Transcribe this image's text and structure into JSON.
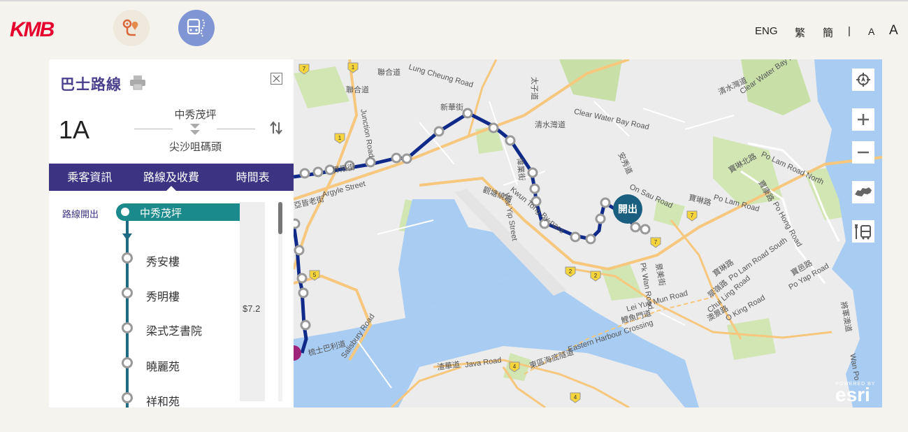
{
  "header": {
    "logo_text": "KMB",
    "route_search_icon": "route-pin-icon",
    "bus_stop_icon": "bus-stop-icon",
    "languages": [
      "ENG",
      "繁",
      "簡"
    ],
    "separator": "|",
    "font_small": "A",
    "font_large": "A",
    "brand_color": "#e5002d"
  },
  "panel": {
    "title": "巴士路線",
    "route_number": "1A",
    "from_terminus": "中秀茂坪",
    "to_terminus": "尖沙咀碼頭",
    "tabs": [
      {
        "label": "乘客資訊",
        "active": false
      },
      {
        "label": "路線及收費",
        "active": true
      },
      {
        "label": "時間表",
        "active": false
      }
    ],
    "origin_label": "路線開出",
    "origin_stop": "中秀茂坪",
    "stops": [
      "秀安樓",
      "秀明樓",
      "梁式芝書院",
      "曉麗苑",
      "祥和苑"
    ],
    "fare": "$7.2",
    "accent_color": "#3c3483",
    "origin_color": "#1a8a8c"
  },
  "map": {
    "start_badge": "開出",
    "labels": [
      "Lung Cheung Road",
      "Junction Road",
      "Clear Water Bay Road",
      "Argyle Street",
      "Kwun Tong By-pass",
      "Wai Yip Street",
      "On Sau Road",
      "Po Lam Road North",
      "Po Lam Road",
      "Po Hong Road",
      "Po Lam Road South",
      "Po Yap Road",
      "Chui Ling Road",
      "O King Road",
      "Wan Po",
      "Eastern Harbour Crossing",
      "Lei Yue Mun Road",
      "Pk Wan Road",
      "Java Road",
      "Salisbury Road",
      "清水灣道",
      "太子道",
      "聯合道",
      "界限街",
      "亞皆老街",
      "觀塘繞道",
      "偉業街",
      "安秀道",
      "寶琳北路",
      "寶琳路",
      "寶康路",
      "寶邑路",
      "翠嶺路",
      "澳景路",
      "將軍澳道",
      "東區海底隧道",
      "鯉魚門道",
      "渣華道",
      "梳士巴利道",
      "景美街",
      "新華街",
      "7",
      "1",
      "5",
      "2",
      "4"
    ],
    "controls": [
      "locate-icon",
      "zoom-in-icon",
      "zoom-out-icon",
      "basemap-icon",
      "bus-stop-legend-icon"
    ],
    "attribution_top": "POWERED BY",
    "attribution": "esri",
    "route_color": "#102a8a"
  }
}
